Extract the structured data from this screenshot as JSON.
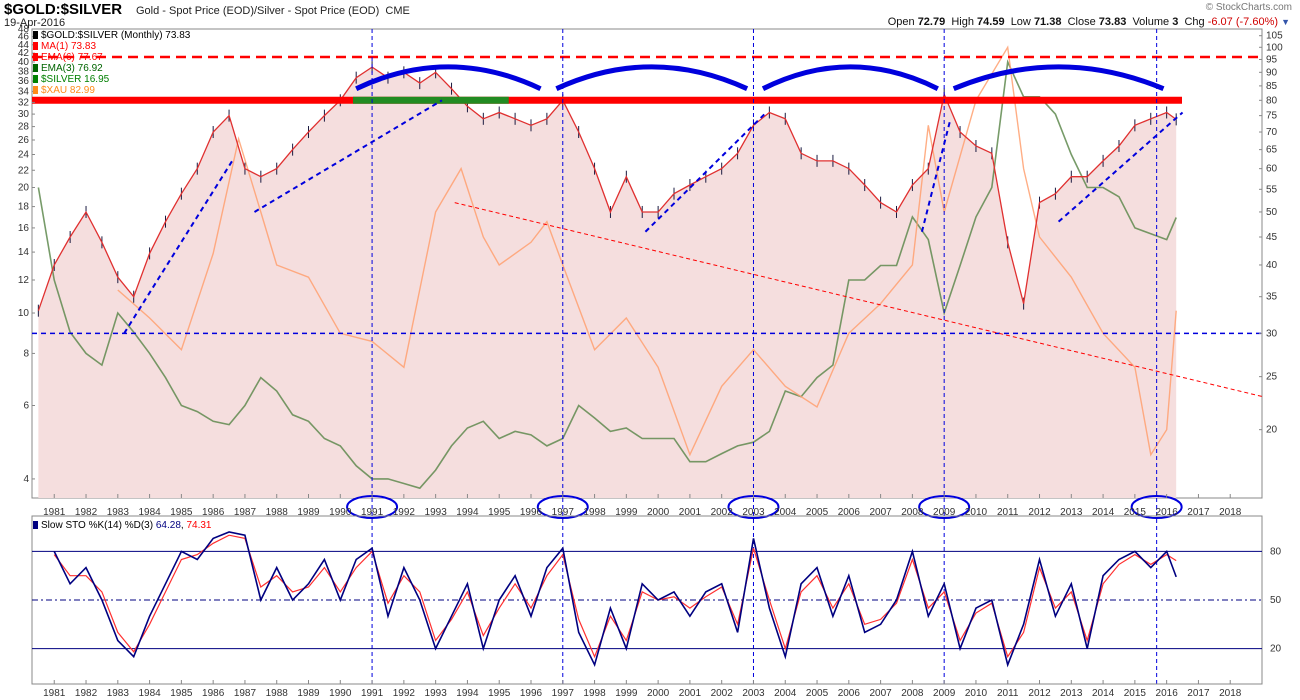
{
  "header": {
    "symbol": "$GOLD:$SILVER",
    "description": "Gold - Spot Price (EOD)/Silver - Spot Price (EOD)",
    "exchange": "CME",
    "date": "19-Apr-2016",
    "brand": "© StockCharts.com",
    "open_label": "Open",
    "open": "72.79",
    "high_label": "High",
    "high": "74.59",
    "low_label": "Low",
    "low": "71.38",
    "close_label": "Close",
    "close": "73.83",
    "volume_label": "Volume",
    "volume": "3",
    "chg_label": "Chg",
    "chg": "-6.07 (-7.60%)",
    "chg_icon": "triangle-down-icon"
  },
  "legend": [
    {
      "text": "$GOLD:$SILVER (Monthly) 73.83",
      "color": "#000000"
    },
    {
      "text": "MA(1) 73.83",
      "color": "#ff0000"
    },
    {
      "text": "EMA(6) 77.67",
      "color": "#ff0000"
    },
    {
      "text": "EMA(3) 76.92",
      "color": "#006400"
    },
    {
      "text": "$SILVER 16.95",
      "color": "#008000"
    },
    {
      "text": "$XAU 82.99",
      "color": "#ff8c1a"
    }
  ],
  "sto_legend": {
    "prefix": "Slow STO %K(14) %D(3)",
    "k": "64.28",
    "d": "74.31",
    "k_color": "#000080",
    "d_color": "#ff0000"
  },
  "colors": {
    "fill": "#f5dede",
    "ratio_line": "#e03030",
    "silver_line": "#5f8a4f",
    "xau_line": "#ffa070",
    "sto_k": "#000080",
    "sto_d": "#ff3030",
    "annotation_blue": "#0000dd",
    "resistance_red": "#ff0000",
    "support_green": "#228b22"
  },
  "chart_data": [
    {
      "type": "line",
      "title": "$GOLD:$SILVER (Monthly) 73.83",
      "x_axis": {
        "type": "year",
        "range": [
          1980.3,
          2019.0
        ],
        "tick_labels": [
          "1981",
          "1982",
          "1983",
          "1984",
          "1985",
          "1986",
          "1987",
          "1988",
          "1989",
          "1990",
          "1991",
          "1992",
          "1993",
          "1994",
          "1995",
          "1996",
          "1997",
          "1998",
          "1999",
          "2000",
          "2001",
          "2002",
          "2003",
          "2004",
          "2005",
          "2006",
          "2007",
          "2008",
          "2009",
          "2010",
          "2011",
          "2012",
          "2013",
          "2014",
          "2015",
          "2016",
          "2017",
          "2018"
        ]
      },
      "y_axis_left": {
        "scale": "log",
        "range": [
          3.6,
          48
        ],
        "tick_labels": [
          "4",
          "6",
          "8",
          "10",
          "12",
          "14",
          "16",
          "18",
          "20",
          "22",
          "24",
          "26",
          "28",
          "30",
          "32",
          "34",
          "36",
          "38",
          "40",
          "42",
          "44",
          "46",
          "48"
        ],
        "series": "$SILVER"
      },
      "y_axis_right": {
        "scale": "log",
        "range": [
          15,
          108
        ],
        "tick_labels": [
          "20",
          "25",
          "30",
          "35",
          "40",
          "45",
          "50",
          "55",
          "60",
          "65",
          "70",
          "75",
          "80",
          "85",
          "90",
          "95",
          "100",
          "105"
        ],
        "series": [
          "$GOLD:$SILVER",
          "$XAU"
        ]
      },
      "series": [
        {
          "name": "$GOLD:$SILVER",
          "axis": "right",
          "x": [
            1980.5,
            1981,
            1981.5,
            1982,
            1982.5,
            1983,
            1983.5,
            1984,
            1984.5,
            1985,
            1985.5,
            1986,
            1986.5,
            1987,
            1987.5,
            1988,
            1988.5,
            1989,
            1989.5,
            1990,
            1990.5,
            1991,
            1991.5,
            1992,
            1992.5,
            1993,
            1993.5,
            1994,
            1994.5,
            1995,
            1995.5,
            1996,
            1996.5,
            1997,
            1997.5,
            1998,
            1998.5,
            1999,
            1999.5,
            2000,
            2000.5,
            2001,
            2001.5,
            2002,
            2002.5,
            2003,
            2003.5,
            2004,
            2004.5,
            2005,
            2005.5,
            2006,
            2006.5,
            2007,
            2007.5,
            2008,
            2008.5,
            2009,
            2009.5,
            2010,
            2010.5,
            2011,
            2011.5,
            2012,
            2012.5,
            2013,
            2013.5,
            2014,
            2014.5,
            2015,
            2015.5,
            2016,
            2016.3
          ],
          "y": [
            33,
            40,
            45,
            50,
            44,
            38,
            35,
            42,
            48,
            54,
            60,
            70,
            75,
            60,
            58,
            60,
            65,
            70,
            75,
            80,
            88,
            92,
            88,
            90,
            86,
            90,
            84,
            78,
            74,
            76,
            74,
            72,
            74,
            80,
            70,
            60,
            50,
            58,
            50,
            50,
            54,
            56,
            58,
            60,
            64,
            72,
            76,
            74,
            64,
            62,
            62,
            60,
            56,
            52,
            50,
            56,
            60,
            82,
            70,
            66,
            64,
            44,
            34,
            52,
            54,
            58,
            58,
            62,
            66,
            72,
            74,
            76,
            73.83
          ]
        },
        {
          "name": "$SILVER",
          "axis": "left",
          "x": [
            1980.5,
            1981,
            1981.5,
            1982,
            1982.5,
            1983,
            1983.5,
            1984,
            1984.5,
            1985,
            1985.5,
            1986,
            1986.5,
            1987,
            1987.5,
            1988,
            1988.5,
            1989,
            1989.5,
            1990,
            1990.5,
            1991,
            1991.5,
            1992,
            1992.5,
            1993,
            1993.5,
            1994,
            1994.5,
            1995,
            1995.5,
            1996,
            1996.5,
            1997,
            1997.5,
            1998,
            1998.5,
            1999,
            1999.5,
            2000,
            2000.5,
            2001,
            2001.5,
            2002,
            2002.5,
            2003,
            2003.5,
            2004,
            2004.5,
            2005,
            2005.5,
            2006,
            2006.5,
            2007,
            2007.5,
            2008,
            2008.5,
            2009,
            2009.5,
            2010,
            2010.5,
            2011,
            2011.5,
            2012,
            2012.5,
            2013,
            2013.5,
            2014,
            2014.5,
            2015,
            2015.5,
            2016,
            2016.3
          ],
          "y": [
            20,
            12,
            9,
            8,
            7.5,
            10,
            9,
            8,
            7,
            6,
            5.8,
            5.5,
            5.4,
            6,
            7,
            6.5,
            5.7,
            5.5,
            5,
            4.8,
            4.3,
            4,
            4,
            3.9,
            3.8,
            4.2,
            4.8,
            5.3,
            5.5,
            5,
            5.2,
            5.1,
            4.8,
            5,
            6,
            5.6,
            5.2,
            5.3,
            5,
            5,
            5,
            4.4,
            4.4,
            4.6,
            4.8,
            4.9,
            5.2,
            6.5,
            6.3,
            7,
            7.5,
            12,
            12,
            13,
            13,
            17,
            15,
            10,
            13,
            17,
            20,
            40,
            33,
            33,
            30,
            24,
            20,
            20,
            19,
            16,
            15.5,
            15,
            16.95
          ]
        },
        {
          "name": "$XAU",
          "axis": "right",
          "x": [
            1983,
            1984,
            1985,
            1986,
            1986.8,
            1987.5,
            1988,
            1989,
            1990,
            1991,
            1992,
            1993,
            1993.8,
            1994.5,
            1995,
            1996,
            1996.5,
            1997,
            1998,
            1999,
            2000,
            2001,
            2002,
            2003,
            2004,
            2005,
            2006,
            2007,
            2008,
            2008.5,
            2009,
            2010,
            2011,
            2011.5,
            2012,
            2013,
            2014,
            2015,
            2015.5,
            2016,
            2016.3
          ],
          "y": [
            36,
            32,
            28,
            42,
            68,
            50,
            40,
            38,
            30,
            29,
            26,
            50,
            60,
            45,
            40,
            44,
            48,
            40,
            28,
            32,
            26,
            18,
            24,
            28,
            24,
            22,
            30,
            34,
            40,
            72,
            50,
            80,
            100,
            60,
            45,
            38,
            30,
            26,
            18,
            20,
            33
          ]
        }
      ],
      "annotations": {
        "resistance_level": 80,
        "upper_dashed_level": 96,
        "lower_dashed_level": 30,
        "cycle_years": [
          "1991",
          "1997",
          "2003",
          "2009",
          "2016"
        ]
      }
    },
    {
      "type": "line",
      "title": "Slow STO %K(14) %D(3) 64.28, 74.31",
      "y_axis_right": {
        "range": [
          0,
          100
        ],
        "tick_labels": [
          "20",
          "50",
          "80"
        ]
      },
      "series": [
        {
          "name": "%K",
          "x": [
            1981,
            1981.5,
            1982,
            1982.5,
            1983,
            1983.5,
            1984,
            1984.5,
            1985,
            1985.5,
            1986,
            1986.5,
            1987,
            1987.5,
            1988,
            1988.5,
            1989,
            1989.5,
            1990,
            1990.5,
            1991,
            1991.5,
            1992,
            1992.5,
            1993,
            1993.5,
            1994,
            1994.5,
            1995,
            1995.5,
            1996,
            1996.5,
            1997,
            1997.5,
            1998,
            1998.5,
            1999,
            1999.5,
            2000,
            2000.5,
            2001,
            2001.5,
            2002,
            2002.5,
            2003,
            2003.5,
            2004,
            2004.5,
            2005,
            2005.5,
            2006,
            2006.5,
            2007,
            2007.5,
            2008,
            2008.5,
            2009,
            2009.5,
            2010,
            2010.5,
            2011,
            2011.5,
            2012,
            2012.5,
            2013,
            2013.5,
            2014,
            2014.5,
            2015,
            2015.5,
            2016,
            2016.3
          ],
          "y": [
            80,
            60,
            70,
            50,
            25,
            15,
            40,
            60,
            80,
            75,
            88,
            92,
            90,
            50,
            70,
            50,
            60,
            75,
            50,
            75,
            82,
            40,
            70,
            50,
            20,
            40,
            60,
            20,
            50,
            65,
            40,
            70,
            82,
            30,
            10,
            45,
            20,
            60,
            50,
            55,
            40,
            55,
            60,
            30,
            88,
            45,
            15,
            60,
            70,
            40,
            65,
            30,
            35,
            50,
            80,
            40,
            60,
            20,
            45,
            50,
            10,
            35,
            75,
            40,
            60,
            20,
            65,
            75,
            80,
            70,
            80,
            64.28
          ]
        },
        {
          "name": "%D",
          "x": [
            1981,
            1981.5,
            1982,
            1982.5,
            1983,
            1983.5,
            1984,
            1984.5,
            1985,
            1985.5,
            1986,
            1986.5,
            1987,
            1987.5,
            1988,
            1988.5,
            1989,
            1989.5,
            1990,
            1990.5,
            1991,
            1991.5,
            1992,
            1992.5,
            1993,
            1993.5,
            1994,
            1994.5,
            1995,
            1995.5,
            1996,
            1996.5,
            1997,
            1997.5,
            1998,
            1998.5,
            1999,
            1999.5,
            2000,
            2000.5,
            2001,
            2001.5,
            2002,
            2002.5,
            2003,
            2003.5,
            2004,
            2004.5,
            2005,
            2005.5,
            2006,
            2006.5,
            2007,
            2007.5,
            2008,
            2008.5,
            2009,
            2009.5,
            2010,
            2010.5,
            2011,
            2011.5,
            2012,
            2012.5,
            2013,
            2013.5,
            2014,
            2014.5,
            2015,
            2015.5,
            2016,
            2016.3
          ],
          "y": [
            78,
            65,
            65,
            55,
            30,
            18,
            35,
            55,
            75,
            78,
            85,
            90,
            88,
            58,
            65,
            55,
            58,
            70,
            55,
            70,
            80,
            48,
            65,
            55,
            25,
            38,
            55,
            28,
            45,
            60,
            45,
            65,
            78,
            38,
            15,
            40,
            25,
            55,
            50,
            52,
            45,
            52,
            58,
            35,
            82,
            50,
            20,
            55,
            65,
            45,
            60,
            35,
            38,
            48,
            75,
            45,
            55,
            25,
            42,
            48,
            15,
            30,
            70,
            45,
            55,
            25,
            60,
            72,
            78,
            72,
            78,
            74.31
          ]
        }
      ],
      "reference_lines": [
        80,
        50,
        20
      ]
    }
  ]
}
